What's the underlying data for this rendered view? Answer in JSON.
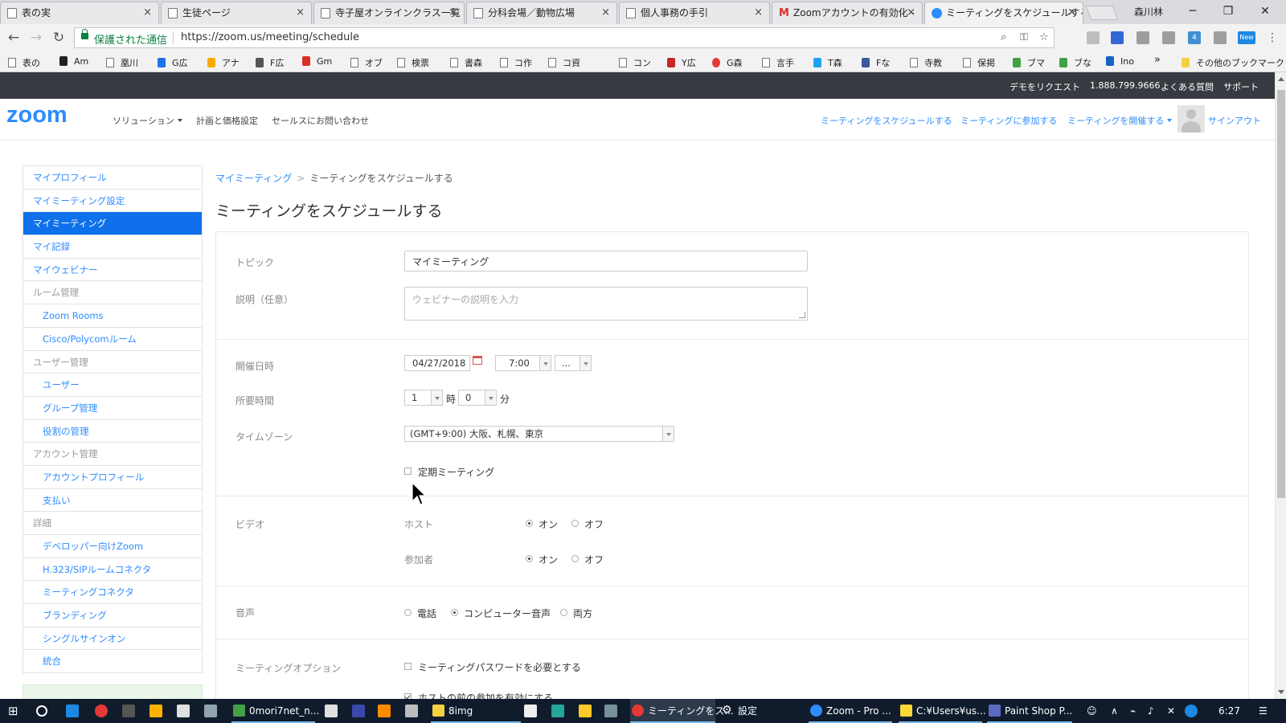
{
  "browser": {
    "tabs": [
      {
        "label": "表の実"
      },
      {
        "label": "生徒ページ"
      },
      {
        "label": "寺子屋オンラインクラス一覧"
      },
      {
        "label": "分科会場／動物広場"
      },
      {
        "label": "個人事務の手引"
      },
      {
        "label": "Zoomアカウントの有効化 -"
      },
      {
        "label": "ミーティングをスケジュールする"
      }
    ],
    "close_glyph": "×",
    "profile_name": "森川林",
    "secure_label": "保護された通信",
    "url": "https://zoom.us/meeting/schedule",
    "bookmarks": [
      "表の",
      "Am",
      "凰川",
      "G広",
      "アナ",
      "F広",
      "Gm",
      "オブ",
      "検票",
      "書森",
      "コ作",
      "コ資",
      "コン",
      "Y広",
      "G森",
      "言手",
      "T森",
      "Fな",
      "寺教",
      "保掲",
      "ブマ",
      "ブな",
      "Ino"
    ],
    "bookmarks_more": "»",
    "other_bookmarks": "その他のブックマーク",
    "ext_badge_4": "4",
    "ext_badge_new": "New"
  },
  "zoom": {
    "topbar": {
      "demo": "デモをリクエスト",
      "phone": "1.888.799.9666",
      "faq": "よくある質問",
      "support": "サポート"
    },
    "logo": "zoom",
    "nav": {
      "solutions": "ソリューション",
      "pricing": "計画と価格設定",
      "contact_sales": "セールスにお問い合わせ",
      "schedule": "ミーティングをスケジュールする",
      "join": "ミーティングに参加する",
      "host": "ミーティングを開催する",
      "signout": "サインアウト"
    },
    "sidebar": [
      {
        "label": "マイプロフィール",
        "kind": "link"
      },
      {
        "label": "マイミーティング設定",
        "kind": "link"
      },
      {
        "label": "マイミーティング",
        "kind": "active"
      },
      {
        "label": "マイ記録",
        "kind": "link"
      },
      {
        "label": "マイウェビナー",
        "kind": "link"
      },
      {
        "label": "ルーム管理",
        "kind": "group"
      },
      {
        "label": "Zoom Rooms",
        "kind": "sub"
      },
      {
        "label": "Cisco/Polycomルーム",
        "kind": "sub"
      },
      {
        "label": "ユーザー管理",
        "kind": "group"
      },
      {
        "label": "ユーザー",
        "kind": "sub"
      },
      {
        "label": "グループ管理",
        "kind": "sub"
      },
      {
        "label": "役割の管理",
        "kind": "sub"
      },
      {
        "label": "アカウント管理",
        "kind": "group"
      },
      {
        "label": "アカウントプロフィール",
        "kind": "sub"
      },
      {
        "label": "支払い",
        "kind": "sub"
      },
      {
        "label": "詳細",
        "kind": "group"
      },
      {
        "label": "デベロッパー向けZoom",
        "kind": "sub"
      },
      {
        "label": "H.323/SIPルームコネクタ",
        "kind": "sub"
      },
      {
        "label": "ミーティングコネクタ",
        "kind": "sub"
      },
      {
        "label": "ブランディング",
        "kind": "sub"
      },
      {
        "label": "シングルサインオン",
        "kind": "sub"
      },
      {
        "label": "統合",
        "kind": "sub"
      }
    ],
    "breadcrumb": {
      "parent": "マイミーティング",
      "separator": ">",
      "current": "ミーティングをスケジュールする"
    },
    "page_title": "ミーティングをスケジュールする",
    "form": {
      "topic_label": "トピック",
      "topic_value": "マイミーティング",
      "description_label": "説明（任意）",
      "description_placeholder": "ウェビナーの説明を入力",
      "when_label": "開催日時",
      "date": "04/27/2018",
      "time": "7:00",
      "ampm": "...",
      "duration_label": "所要時間",
      "duration_hours": "1",
      "hours_unit": "時",
      "duration_minutes": "0",
      "minutes_unit": "分",
      "timezone_label": "タイムゾーン",
      "timezone": "(GMT+9:00) 大阪、札幌、東京",
      "recurring_label": "定期ミーティング",
      "recurring_checked": false,
      "video_label": "ビデオ",
      "host_label": "ホスト",
      "participants_label": "参加者",
      "on_label": "オン",
      "off_label": "オフ",
      "host_video": "on",
      "participant_video": "on",
      "audio_label": "音声",
      "audio_options": [
        "電話",
        "コンピューター音声",
        "両方"
      ],
      "audio_selected": "コンピューター音声",
      "options_label": "ミーティングオプション",
      "require_password_label": "ミーティングパスワードを必要とする",
      "require_password_checked": false,
      "join_before_host_label": "ホストの前の参加を有効にする",
      "join_before_host_checked": true
    }
  },
  "taskbar": {
    "apps": [
      {
        "label": "0mori7net_n..."
      },
      {
        "label": "8img"
      },
      {
        "label": "ミーティングをス..."
      },
      {
        "label": "設定"
      },
      {
        "label": "Zoom - Pro ..."
      },
      {
        "label": "C:¥Users¥us..."
      },
      {
        "label": "Paint Shop P..."
      }
    ],
    "clock": "6:27"
  }
}
